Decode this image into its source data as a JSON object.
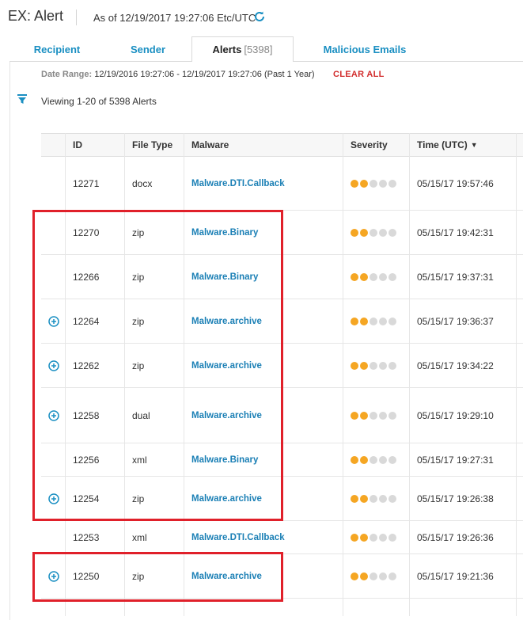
{
  "header": {
    "title": "EX: Alert",
    "as_of": "As of 12/19/2017 19:27:06 Etc/UTC"
  },
  "tabs": [
    {
      "label": "Recipient",
      "count": "",
      "active": false
    },
    {
      "label": "Sender",
      "count": "",
      "active": false
    },
    {
      "label": "Alerts",
      "count": "[5398]",
      "active": true
    },
    {
      "label": "Malicious Emails",
      "count": "",
      "active": false
    }
  ],
  "filters": {
    "date_range_label": "Date Range:",
    "date_range_value": "12/19/2016 19:27:06 - 12/19/2017 19:27:06 (Past 1 Year)",
    "clear_all": "CLEAR ALL",
    "viewing": "Viewing 1-20 of 5398 Alerts"
  },
  "colors": {
    "accent": "#1a8fc2",
    "link": "#1a7fb5",
    "danger": "#d22d2d",
    "severity_on": "#f5a623",
    "severity_off": "#d9d9d9",
    "highlight": "#e0202a"
  },
  "table": {
    "columns": [
      "ID",
      "File Type",
      "Malware",
      "Severity",
      "Time (UTC)"
    ],
    "rows": [
      {
        "expandable": false,
        "id": "12271",
        "file_type": "docx",
        "malware": "Malware.DTI.Callback",
        "severity": 2,
        "time": "05/15/17 19:57:46"
      },
      {
        "expandable": false,
        "id": "12270",
        "file_type": "zip",
        "malware": "Malware.Binary",
        "severity": 2,
        "time": "05/15/17 19:42:31"
      },
      {
        "expandable": false,
        "id": "12266",
        "file_type": "zip",
        "malware": "Malware.Binary",
        "severity": 2,
        "time": "05/15/17 19:37:31"
      },
      {
        "expandable": true,
        "id": "12264",
        "file_type": "zip",
        "malware": "Malware.archive",
        "severity": 2,
        "time": "05/15/17 19:36:37"
      },
      {
        "expandable": true,
        "id": "12262",
        "file_type": "zip",
        "malware": "Malware.archive",
        "severity": 2,
        "time": "05/15/17 19:34:22"
      },
      {
        "expandable": true,
        "id": "12258",
        "file_type": "dual",
        "malware": "Malware.archive",
        "severity": 2,
        "time": "05/15/17 19:29:10"
      },
      {
        "expandable": false,
        "id": "12256",
        "file_type": "xml",
        "malware": "Malware.Binary",
        "severity": 2,
        "time": "05/15/17 19:27:31"
      },
      {
        "expandable": true,
        "id": "12254",
        "file_type": "zip",
        "malware": "Malware.archive",
        "severity": 2,
        "time": "05/15/17 19:26:38"
      },
      {
        "expandable": false,
        "id": "12253",
        "file_type": "xml",
        "malware": "Malware.DTI.Callback",
        "severity": 2,
        "time": "05/15/17 19:26:36"
      },
      {
        "expandable": true,
        "id": "12250",
        "file_type": "zip",
        "malware": "Malware.archive",
        "severity": 2,
        "time": "05/15/17 19:21:36"
      }
    ]
  }
}
